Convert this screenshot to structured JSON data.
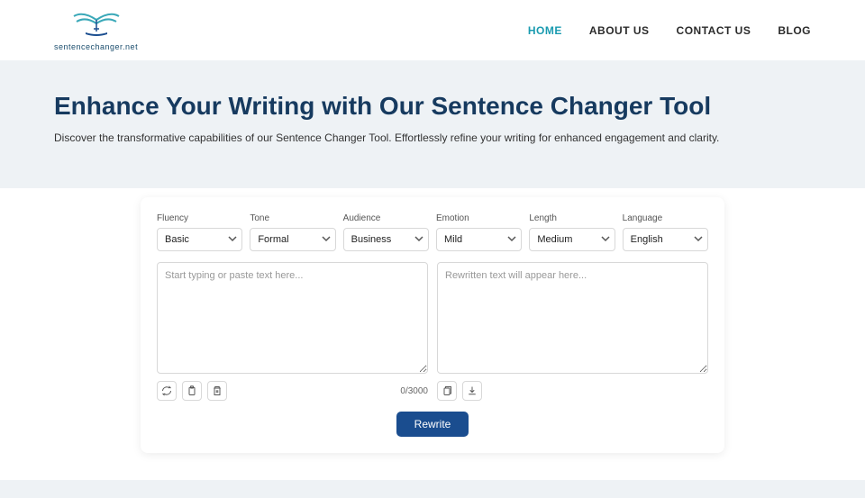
{
  "logo": {
    "text": "sentencechanger.net"
  },
  "nav": {
    "home": "HOME",
    "about": "ABOUT US",
    "contact": "CONTACT US",
    "blog": "BLOG"
  },
  "hero": {
    "title": "Enhance Your Writing with Our Sentence Changer Tool",
    "subtitle": "Discover the transformative capabilities of our Sentence Changer Tool. Effortlessly refine your writing for enhanced engagement and clarity."
  },
  "controls": {
    "fluency": {
      "label": "Fluency",
      "value": "Basic"
    },
    "tone": {
      "label": "Tone",
      "value": "Formal"
    },
    "audience": {
      "label": "Audience",
      "value": "Business"
    },
    "emotion": {
      "label": "Emotion",
      "value": "Mild"
    },
    "length": {
      "label": "Length",
      "value": "Medium"
    },
    "language": {
      "label": "Language",
      "value": "English"
    }
  },
  "input": {
    "placeholder": "Start typing or paste text here...",
    "value": ""
  },
  "output": {
    "placeholder": "Rewritten text will appear here...",
    "value": ""
  },
  "counter": "0/3000",
  "rewrite_label": "Rewrite"
}
